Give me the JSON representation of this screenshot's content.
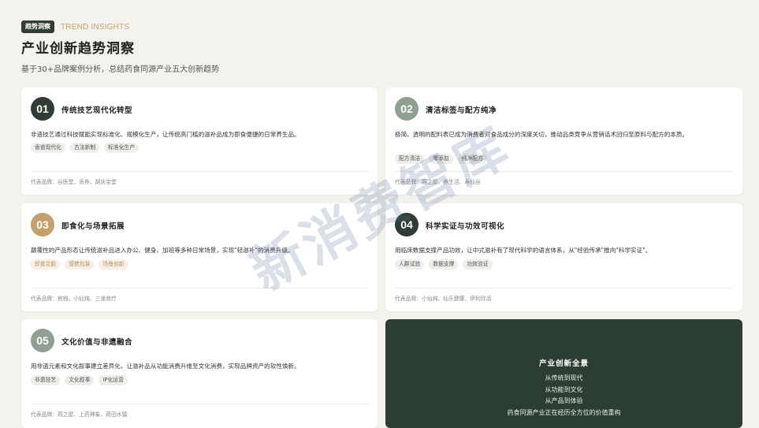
{
  "header": {
    "tag": "趋势洞察",
    "tag_en": "TREND INSIGHTS",
    "title": "产业创新趋势洞察",
    "subtitle": "基于30+品牌案例分析，总结药食同源产业五大创新趋势"
  },
  "colors": {
    "dark_green": "#2f3d35",
    "sage": "#8f9f92",
    "tan": "#c4a06b",
    "card_bg": "#ffffff",
    "page_bg": "#f4f2ed"
  },
  "cards": [
    {
      "number": "01",
      "title": "传统技艺现代化转型",
      "desc": "非遗技艺通过科技赋能实现标准化、规模化生产，让传统高门槛的滋补品成为即食便捷的日常养生品。",
      "chips": [
        "香道现代化",
        "古法新制",
        "标准化生产"
      ],
      "brands": "代表品牌：谷医堂、贡养、胡庆余堂"
    },
    {
      "number": "02",
      "title": "清洁标签与配方纯净",
      "desc": "极简、透明的配料表已成为消费者对食品成分的深度关切，推动品类竞争从营销话术回归至原料与配方的本质。",
      "chips": [
        "配方清洁",
        "零添加",
        "纯净配方"
      ],
      "brands": "代表品牌：燕之屋、养生活、寿仙谷"
    },
    {
      "number": "03",
      "title": "即食化与场景拓展",
      "desc": "颠覆性的产品形态让传统滋补品进入办公、健身、加班等多种日常场景，实现\"轻滋补\"的消费升级。",
      "chips": [
        "即食花胶",
        "便携包装",
        "场景创新"
      ],
      "brands": "代表品牌：官栈、小仙炖、三道食疗"
    },
    {
      "number": "04",
      "title": "科学实证与功效可视化",
      "desc": "用临床数据支撑产品功效，让中式滋补有了现代科学的语言体系，从\"经验传承\"推向\"科学实证\"。",
      "chips": [
        "人群试验",
        "数据支撑",
        "功效验证"
      ],
      "brands": "代表品牌：小仙炖、仙乐健康、伊利欣活"
    },
    {
      "number": "05",
      "title": "文化价值与非遗融合",
      "desc": "用非遗元素和文化叙事建立差异化，让滋补品从功能消费升维至文化消费，实现品牌资产的软性焕新。",
      "chips": [
        "非遗技艺",
        "文化叙事",
        "IP化运营"
      ],
      "brands": "代表品牌：燕之屋、上药神象、荷田水镇"
    }
  ],
  "summary": {
    "title": "产业创新全景",
    "lines": [
      "从传统到现代",
      "从功能到文化",
      "从产品到体验",
      "药食同源产业正在经历全方位的价值重构"
    ]
  },
  "watermark": "新消费智库"
}
